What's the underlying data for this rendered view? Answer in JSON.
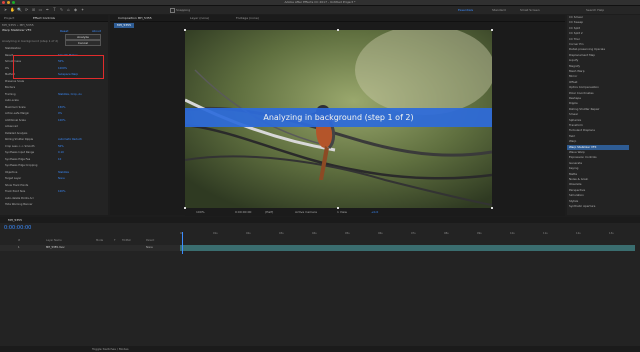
{
  "window": {
    "title": "Adobe After Effects CC 2017 - Untitled Project *"
  },
  "toolbar": {
    "tools": [
      "➤",
      "✋",
      "🔍",
      "⟳",
      "⊞",
      "▭",
      "✒",
      "T",
      "✎",
      "⌂",
      "◆",
      "✦"
    ],
    "snapping": "Snapping",
    "workspaces": [
      "Essentials",
      "Standard",
      "Small Screen"
    ],
    "active_workspace": "Essentials",
    "search_help": "Search Help"
  },
  "left_panel": {
    "tabs": [
      "Project",
      "Effect Controls"
    ],
    "comp_label": "MH_5355 • MH_5355",
    "effect_name": "Warp Stabilizer VFX",
    "reset": "Reset",
    "about": "About",
    "analyze_button": "Analyze",
    "cancel_button": "Cancel",
    "status": "Analyzing in background (step 1 of 2)",
    "rows": [
      {
        "label": "Stabilization",
        "value": ""
      },
      {
        "label": "Result",
        "value": "Smooth Motion"
      },
      {
        "label": "Smoothness",
        "value": "50%"
      },
      {
        "label": "0%",
        "value": "1000%"
      },
      {
        "label": "Method",
        "value": "Subspace Warp"
      },
      {
        "label": "Preserve Scale",
        "value": ""
      },
      {
        "label": "Borders",
        "value": ""
      },
      {
        "label": "Framing",
        "value": "Stabilize, Crop, Au"
      },
      {
        "label": "Auto-scale",
        "value": ""
      },
      {
        "label": "Maximum Scale",
        "value": "150%"
      },
      {
        "label": "Action-safe Margin",
        "value": "0%"
      },
      {
        "label": "Additional Scale",
        "value": "100%"
      },
      {
        "label": "Advanced",
        "value": ""
      },
      {
        "label": "Detailed Analysis",
        "value": ""
      },
      {
        "label": "Rolling Shutter Ripple",
        "value": "Automatic Reducti"
      },
      {
        "label": "Crop Less <-> Smooth",
        "value": "50%"
      },
      {
        "label": "Synthesis Input Range",
        "value": "0.10"
      },
      {
        "label": "Synthesis Edge Fea",
        "value": "10"
      },
      {
        "label": "Synthesis Edge Cropping",
        "value": ""
      },
      {
        "label": "Objective",
        "value": "Stabilize"
      },
      {
        "label": "Target Layer",
        "value": "None"
      },
      {
        "label": "Show Track Points",
        "value": ""
      },
      {
        "label": "Track Point Size",
        "value": "100%"
      },
      {
        "label": "Auto-delete Points Acr",
        "value": ""
      },
      {
        "label": "Hide Warning Banner",
        "value": ""
      }
    ]
  },
  "comp_panel": {
    "tabs": [
      "Composition MH_5355",
      "Layer (none)",
      "Footage (none)"
    ],
    "comp_tab": "MH_5355",
    "banner_text": "Analyzing in background (step 1 of 2)",
    "viewer_bar": [
      "100%",
      "0:00:00:00",
      "(Half)",
      "Active Camera",
      "1 View",
      "+0.0"
    ]
  },
  "effects_panel": {
    "items": [
      "CC Smear",
      "CC Sweep",
      "CC Split",
      "CC Split 2",
      "CC Tiler",
      "Corner Pin",
      "Detail-preserving Upscale",
      "Displacement Map",
      "Liquify",
      "Magnify",
      "Mesh Warp",
      "Mirror",
      "Offset",
      "Optics Compensation",
      "Polar Coordinates",
      "Reshape",
      "Ripple",
      "Rolling Shutter Repair",
      "Smear",
      "Spherize",
      "Transform",
      "Turbulent Displace",
      "Twirl",
      "Warp",
      "Warp Stabilizer VFX",
      "Wave Warp",
      "Expression Controls",
      "Generate",
      "Keying",
      "Matte",
      "Noise & Grain",
      "Obsolete",
      "Perspective",
      "Simulation",
      "Stylize",
      "Synthetic Aperture"
    ],
    "selected": "Warp Stabilizer VFX"
  },
  "timeline": {
    "tab": "MH_5355",
    "timecode": "0:00:00:00",
    "columns": [
      "#",
      "Layer Name",
      "Mode",
      "T",
      "TrkMat",
      "Parent"
    ],
    "layer": {
      "num": "1",
      "name": "MH_5355.mov",
      "parent": "None"
    },
    "ruler": [
      "0s",
      "01s",
      "02s",
      "03s",
      "04s",
      "05s",
      "06s",
      "07s",
      "08s",
      "09s",
      "10s",
      "11s",
      "12s",
      "13s"
    ],
    "bottom": "Toggle Switches / Modes"
  }
}
